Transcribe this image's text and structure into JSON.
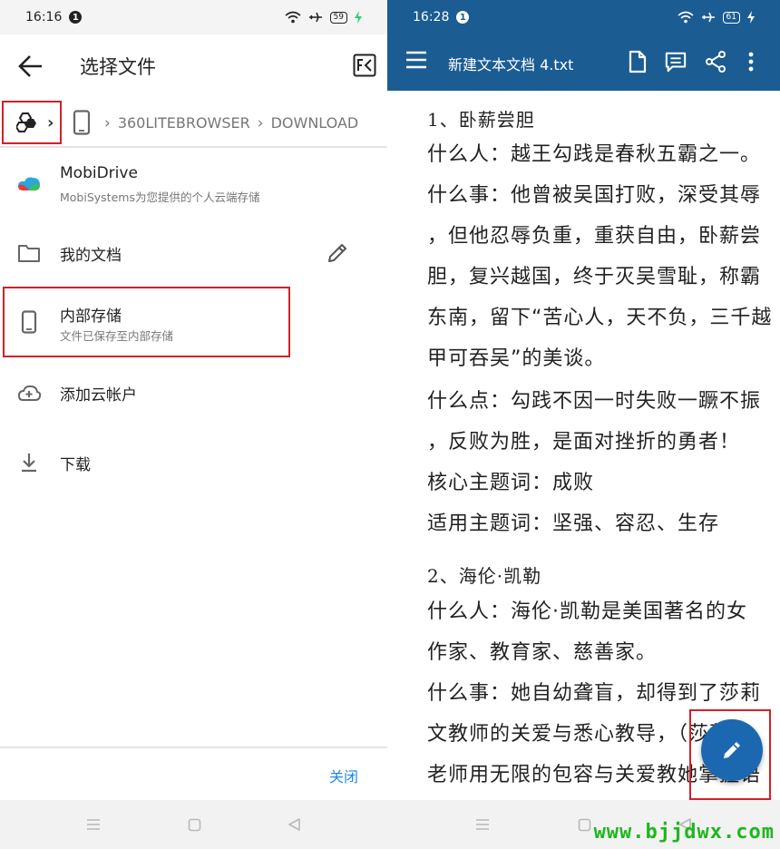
{
  "left": {
    "status": {
      "time": "16:16",
      "badge": "1",
      "battery": "59"
    },
    "header": {
      "title": "选择文件"
    },
    "breadcrumb": {
      "items": [
        "360LITEBROWSER",
        "DOWNLOAD"
      ]
    },
    "list": [
      {
        "title": "MobiDrive",
        "subtitle": "MobiSystems为您提供的个人云端存储",
        "icon": "mobidrive-logo"
      },
      {
        "title": "我的文档",
        "icon": "folder-icon"
      },
      {
        "title": "内部存储",
        "subtitle": "文件已保存至内部存储",
        "icon": "phone-icon"
      },
      {
        "title": "添加云帐户",
        "icon": "cloud-add-icon"
      },
      {
        "title": "下载",
        "icon": "download-icon"
      }
    ],
    "footer": {
      "close_label": "关闭"
    }
  },
  "right": {
    "status": {
      "time": "16:28",
      "badge": "1",
      "battery": "61"
    },
    "header": {
      "title": "新建文本文档 4.txt"
    },
    "doc_lines": [
      "1、卧薪尝胆",
      "什么人：越王勾践是春秋五霸之一。",
      "什么事：他曾被吴国打败，深受其辱",
      "，但他忍辱负重，重获自由，卧薪尝",
      "胆，复兴越国，终于灭吴雪耻，称霸",
      "东南，留下“苦心人，天不负，三千越",
      "甲可吞吴”的美谈。",
      "什么点：勾践不因一时失败一蹶不振",
      "，反败为胜，是面对挫折的勇者！",
      "核心主题词：成败",
      "适用主题词：坚强、容忍、生存",
      "2、海伦·凯勒",
      "什么人：海伦·凯勒是美国著名的女",
      "作家、教育家、慈善家。",
      "什么事：她自幼聋盲，却得到了莎莉",
      "文教师的关爱与悉心教导，（莎莉文",
      "老师用无限的包容与关爱教她掌握语"
    ],
    "watermark": "www.bjjdwx.com"
  },
  "colors": {
    "accent_blue": "#1b5c92",
    "highlight_red": "#d32027",
    "link_blue": "#1e88e5"
  }
}
